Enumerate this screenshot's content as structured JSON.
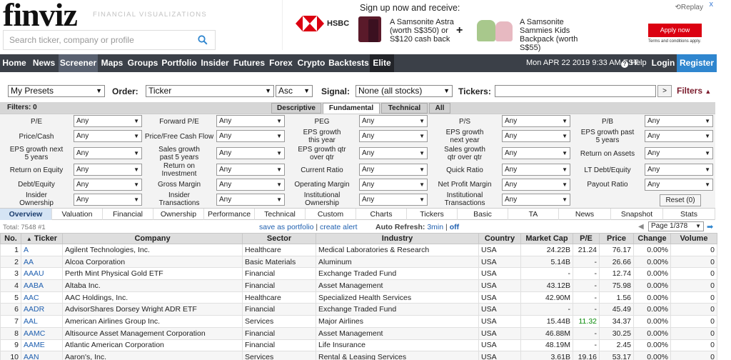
{
  "header": {
    "logo": "finviz",
    "tagline": "FINANCIAL VISUALIZATIONS",
    "search_placeholder": "Search ticker, company or profile"
  },
  "ad": {
    "headline": "Sign up now and receive:",
    "replay": "Replay",
    "close": "x",
    "brand": "HSBC",
    "offer1": "A Samsonite Astra (worth S$350) or S$120 cash back",
    "plus": "+",
    "offer2": "A Samsonite Sammies Kids Backpack (worth S$55)",
    "apply": "Apply now",
    "terms": "Terms and conditions apply."
  },
  "nav": {
    "items": [
      "Home",
      "News",
      "Screener",
      "Maps",
      "Groups",
      "Portfolio",
      "Insider",
      "Futures",
      "Forex",
      "Crypto",
      "Backtests",
      "Elite"
    ],
    "date": "Mon APR 22 2019 9:33 AM EST",
    "help": "Help",
    "login": "Login",
    "register": "Register"
  },
  "controls": {
    "presets": "My Presets",
    "order_label": "Order:",
    "order_value": "Ticker",
    "direction": "Asc",
    "signal_label": "Signal:",
    "signal_value": "None (all stocks)",
    "tickers_label": "Tickers:",
    "go": ">",
    "filters_link": "Filters"
  },
  "filters": {
    "count_label": "Filters: 0",
    "tabs": [
      "Descriptive",
      "Fundamental",
      "Technical",
      "All"
    ],
    "rows": [
      [
        "P/E",
        "Forward P/E",
        "PEG",
        "P/S",
        "P/B"
      ],
      [
        "Price/Cash",
        "Price/Free Cash Flow",
        "EPS growth this year",
        "EPS growth next year",
        "EPS growth past 5 years"
      ],
      [
        "EPS growth next 5 years",
        "Sales growth past 5 years",
        "EPS growth qtr over qtr",
        "Sales growth qtr over qtr",
        "Return on Assets"
      ],
      [
        "Return on Equity",
        "Return on Investment",
        "Current Ratio",
        "Quick Ratio",
        "LT Debt/Equity"
      ],
      [
        "Debt/Equity",
        "Gross Margin",
        "Operating Margin",
        "Net Profit Margin",
        "Payout Ratio"
      ],
      [
        "Insider Ownership",
        "Insider Transactions",
        "Institutional Ownership",
        "Institutional Transactions"
      ]
    ],
    "any": "Any",
    "reset": "Reset (0)"
  },
  "view_tabs": [
    "Overview",
    "Valuation",
    "Financial",
    "Ownership",
    "Performance",
    "Technical",
    "Custom",
    "Charts",
    "Tickers",
    "Basic",
    "TA",
    "News",
    "Snapshot",
    "Stats"
  ],
  "summary": {
    "total": "Total: 7548 #1",
    "save_portfolio": "save as portfolio",
    "sep": "|",
    "create_alert": "create alert",
    "auto_refresh": "Auto Refresh:",
    "interval": "3min",
    "off": "off",
    "page": "Page 1/378"
  },
  "table": {
    "columns": [
      "No.",
      "Ticker",
      "Company",
      "Sector",
      "Industry",
      "Country",
      "Market Cap",
      "P/E",
      "Price",
      "Change",
      "Volume"
    ],
    "rows": [
      [
        "1",
        "A",
        "Agilent Technologies, Inc.",
        "Healthcare",
        "Medical Laboratories & Research",
        "USA",
        "24.22B",
        "21.24",
        "76.17",
        "0.00%",
        "0"
      ],
      [
        "2",
        "AA",
        "Alcoa Corporation",
        "Basic Materials",
        "Aluminum",
        "USA",
        "5.14B",
        "-",
        "26.66",
        "0.00%",
        "0"
      ],
      [
        "3",
        "AAAU",
        "Perth Mint Physical Gold ETF",
        "Financial",
        "Exchange Traded Fund",
        "USA",
        "-",
        "-",
        "12.74",
        "0.00%",
        "0"
      ],
      [
        "4",
        "AABA",
        "Altaba Inc.",
        "Financial",
        "Asset Management",
        "USA",
        "43.12B",
        "-",
        "75.98",
        "0.00%",
        "0"
      ],
      [
        "5",
        "AAC",
        "AAC Holdings, Inc.",
        "Healthcare",
        "Specialized Health Services",
        "USA",
        "42.90M",
        "-",
        "1.56",
        "0.00%",
        "0"
      ],
      [
        "6",
        "AADR",
        "AdvisorShares Dorsey Wright ADR ETF",
        "Financial",
        "Exchange Traded Fund",
        "USA",
        "-",
        "-",
        "45.49",
        "0.00%",
        "0"
      ],
      [
        "7",
        "AAL",
        "American Airlines Group Inc.",
        "Services",
        "Major Airlines",
        "USA",
        "15.44B",
        "11.32",
        "34.37",
        "0.00%",
        "0"
      ],
      [
        "8",
        "AAMC",
        "Altisource Asset Management Corporation",
        "Financial",
        "Asset Management",
        "USA",
        "46.88M",
        "-",
        "30.25",
        "0.00%",
        "0"
      ],
      [
        "9",
        "AAME",
        "Atlantic American Corporation",
        "Financial",
        "Life Insurance",
        "USA",
        "48.19M",
        "-",
        "2.45",
        "0.00%",
        "0"
      ],
      [
        "10",
        "AAN",
        "Aaron's, Inc.",
        "Services",
        "Rental & Leasing Services",
        "USA",
        "3.61B",
        "19.16",
        "53.17",
        "0.00%",
        "0"
      ]
    ]
  },
  "colors": {
    "nav_bg": "#3b4048",
    "nav_active": "#596170",
    "register": "#2f86cf",
    "link": "#2060b0",
    "filters_link": "#7b1c2d",
    "hsbc_red": "#db0011"
  }
}
